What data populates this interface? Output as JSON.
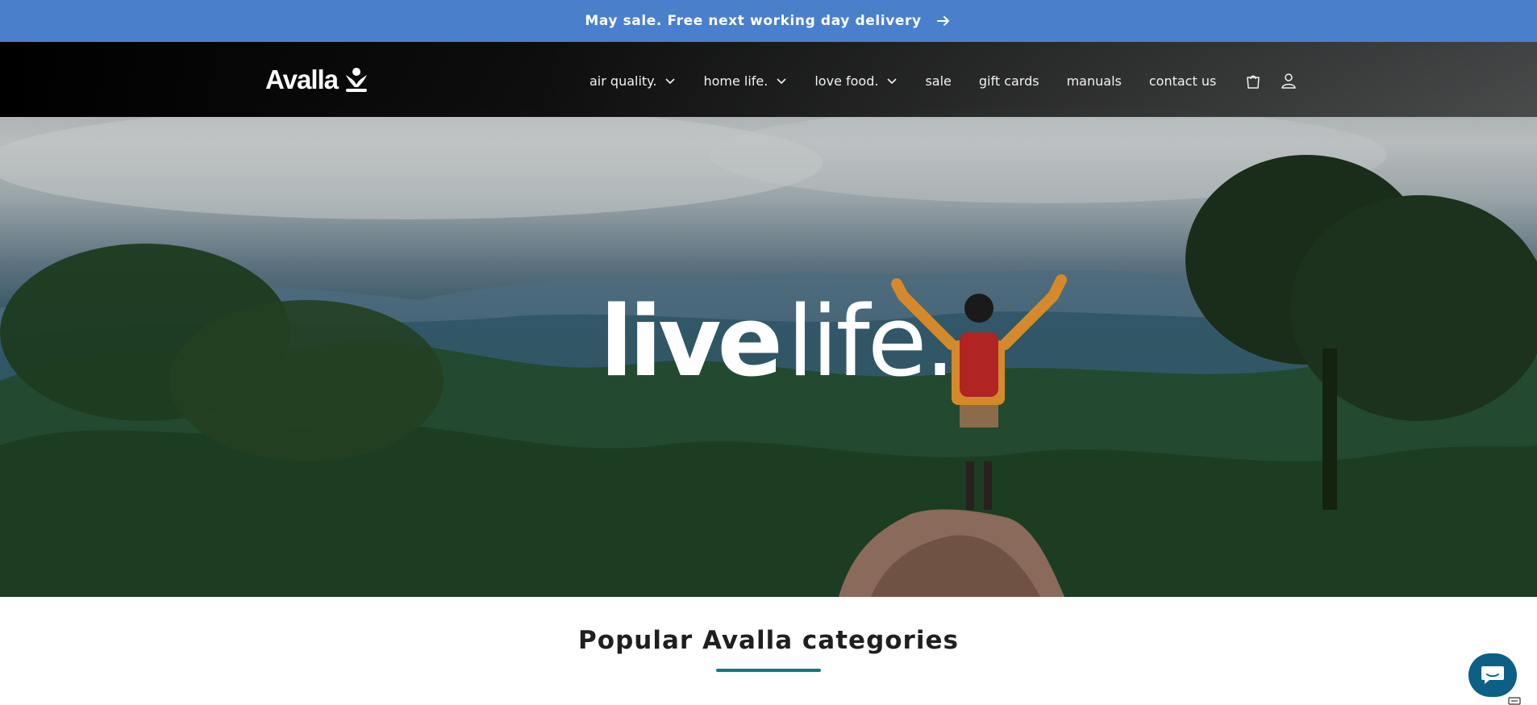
{
  "announcement": {
    "text": "May sale. Free next working day delivery",
    "icon": "arrow-right-icon"
  },
  "header": {
    "logo_text": "Avalla",
    "logo_icon": "sprout-person-icon",
    "nav": [
      {
        "label": "air quality.",
        "has_dropdown": true
      },
      {
        "label": "home life.",
        "has_dropdown": true
      },
      {
        "label": "love food.",
        "has_dropdown": true
      },
      {
        "label": "sale",
        "has_dropdown": false
      },
      {
        "label": "gift cards",
        "has_dropdown": false
      },
      {
        "label": "manuals",
        "has_dropdown": false
      },
      {
        "label": "contact us",
        "has_dropdown": false
      }
    ],
    "cart_icon": "shopping-bag-icon",
    "account_icon": "user-icon"
  },
  "hero": {
    "headline_bold": "live",
    "headline_light": "life."
  },
  "section": {
    "title": "Popular Avalla categories",
    "accent_color": "#0e7a82"
  },
  "colors": {
    "announcement_bg": "#4a7fcc",
    "chat_bg": "#0c5f85"
  },
  "chat": {
    "icon": "chat-bubble-icon"
  }
}
